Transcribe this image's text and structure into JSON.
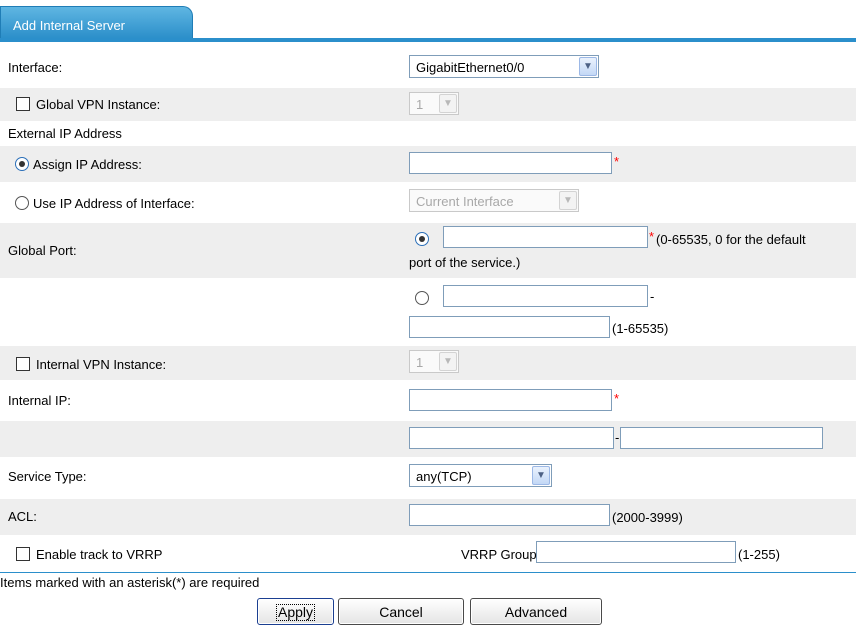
{
  "tab": {
    "label": "Add Internal Server"
  },
  "interface": {
    "label": "Interface:",
    "value": "GigabitEthernet0/0"
  },
  "global_vpn": {
    "label": "Global VPN Instance:",
    "value": "1",
    "checked": false
  },
  "external_ip": {
    "heading": "External IP Address",
    "assign_label": "Assign IP Address:",
    "assign_value": "",
    "use_interface_label": "Use IP Address of Interface:",
    "use_interface_value": "Current Interface"
  },
  "global_port": {
    "label": "Global Port:",
    "single_value": "",
    "single_hint_1": "(0-65535, 0 for the default",
    "single_hint_2": "port of the service.)",
    "range_start": "",
    "range_sep": "-",
    "range_end": "",
    "range_hint": "(1-65535)"
  },
  "internal_vpn": {
    "label": "Internal VPN Instance:",
    "value": "1",
    "checked": false
  },
  "internal_ip": {
    "label": "Internal IP:",
    "value": "",
    "range_start": "",
    "range_sep": "-",
    "range_end": ""
  },
  "service_type": {
    "label": "Service Type:",
    "value": "any(TCP)"
  },
  "acl": {
    "label": "ACL:",
    "value": "",
    "hint": "(2000-3999)"
  },
  "vrrp": {
    "track_label": "Enable track to VRRP",
    "group_label": "VRRP Group:",
    "group_value": "",
    "group_hint": "(1-255)"
  },
  "required_asterisk": "*",
  "footer": {
    "note": "Items marked with an asterisk(*) are required",
    "apply": "Apply",
    "cancel": "Cancel",
    "advanced": "Advanced"
  },
  "colors": {
    "accent": "#2b8fcb",
    "shade": "#eeeeee",
    "required": "#ff0000"
  }
}
